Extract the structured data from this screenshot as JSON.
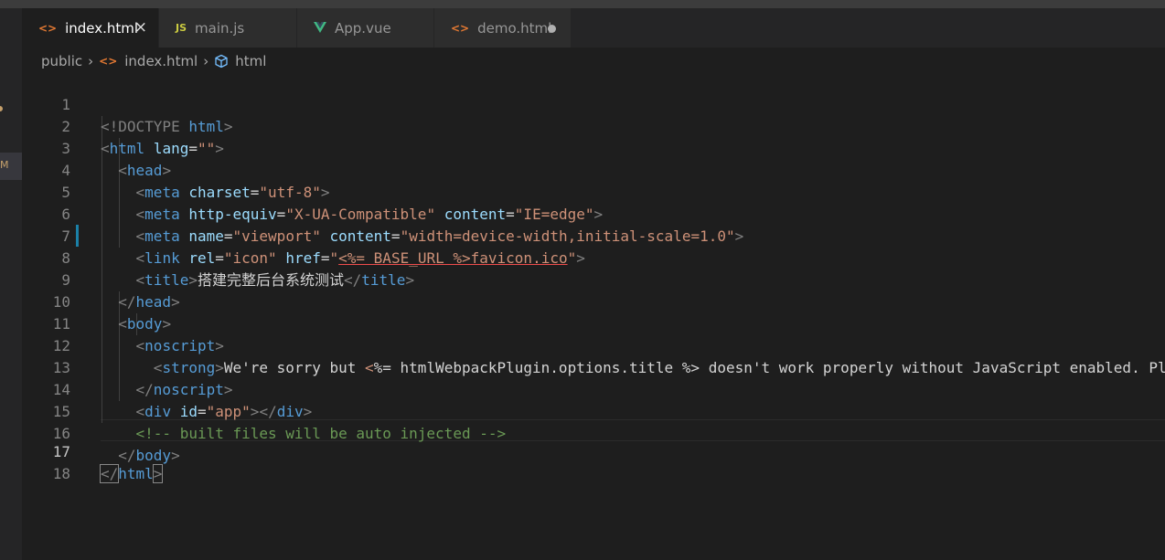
{
  "tabs": [
    {
      "label": "index.html",
      "icon": "html-file-icon",
      "active": true,
      "close": "×"
    },
    {
      "label": "main.js",
      "icon": "js-file-icon",
      "icon_text": "JS",
      "active": false
    },
    {
      "label": "App.vue",
      "icon": "vue-file-icon",
      "active": false
    },
    {
      "label": "demo.html",
      "icon": "html-file-icon",
      "active": false,
      "unsaved": true
    }
  ],
  "activity_bar": {
    "badge": "M"
  },
  "breadcrumb": {
    "folder": "public",
    "file": "index.html",
    "symbol": "html"
  },
  "line_numbers": [
    "1",
    "2",
    "3",
    "4",
    "5",
    "6",
    "7",
    "8",
    "9",
    "10",
    "11",
    "12",
    "13",
    "14",
    "15",
    "16",
    "17",
    "18"
  ],
  "current_line": 17,
  "code": {
    "l1": {
      "doctype": "<!DOCTYPE",
      "html": "html",
      "close": ">"
    },
    "l2": {
      "open": "<",
      "tag": "html",
      "attr": "lang",
      "eq": "=",
      "val": "\"\"",
      "close": ">"
    },
    "l3": {
      "open": "<",
      "tag": "head",
      "close": ">"
    },
    "l4": {
      "open": "<",
      "tag": "meta",
      "attr": "charset",
      "eq": "=",
      "val": "\"utf-8\"",
      "close": ">"
    },
    "l5": {
      "open": "<",
      "tag": "meta",
      "attr1": "http-equiv",
      "eq": "=",
      "val1": "\"X-UA-Compatible\"",
      "attr2": "content",
      "val2": "\"IE=edge\"",
      "close": ">"
    },
    "l6": {
      "open": "<",
      "tag": "meta",
      "attr1": "name",
      "eq": "=",
      "val1": "\"viewport\"",
      "attr2": "content",
      "val2": "\"width=device-width,initial-scale=1.0\"",
      "close": ">"
    },
    "l7": {
      "open": "<",
      "tag": "link",
      "attr1": "rel",
      "eq": "=",
      "val1": "\"icon\"",
      "attr2": "href",
      "val2a": "\"",
      "val2b": "<%= BASE_URL %>favicon.ico",
      "val2c": "\"",
      "close": ">"
    },
    "l8": {
      "open": "<",
      "tag": "title",
      "close": ">",
      "text": "搭建完整后台系统测试",
      "end_open": "</",
      "end_tag": "title",
      "end_close": ">"
    },
    "l9": {
      "open": "</",
      "tag": "head",
      "close": ">"
    },
    "l10": {
      "open": "<",
      "tag": "body",
      "close": ">"
    },
    "l11": {
      "open": "<",
      "tag": "noscript",
      "close": ">"
    },
    "l12": {
      "open": "<",
      "tag": "strong",
      "close": ">",
      "text1": "We're sorry but ",
      "ejs_open": "<",
      "text2": "%= htmlWebpackPlugin.options.title %> doesn't work properly without JavaScript enabled. Pl"
    },
    "l13": {
      "open": "</",
      "tag": "noscript",
      "close": ">"
    },
    "l14": {
      "open": "<",
      "tag": "div",
      "attr": "id",
      "eq": "=",
      "val": "\"app\"",
      "close": ">",
      "end_open": "</",
      "end_tag": "div",
      "end_close": ">"
    },
    "l15": {
      "comment": "<!-- built files will be auto injected -->"
    },
    "l16": {
      "open": "</",
      "tag": "body",
      "close": ">"
    },
    "l17": {
      "open": "</",
      "tag": "html",
      "close": ">"
    }
  },
  "colors": {
    "tag": "#569cd6",
    "attribute": "#9cdcfe",
    "string": "#ce9178",
    "comment": "#6a9955",
    "punctuation": "#808080"
  }
}
